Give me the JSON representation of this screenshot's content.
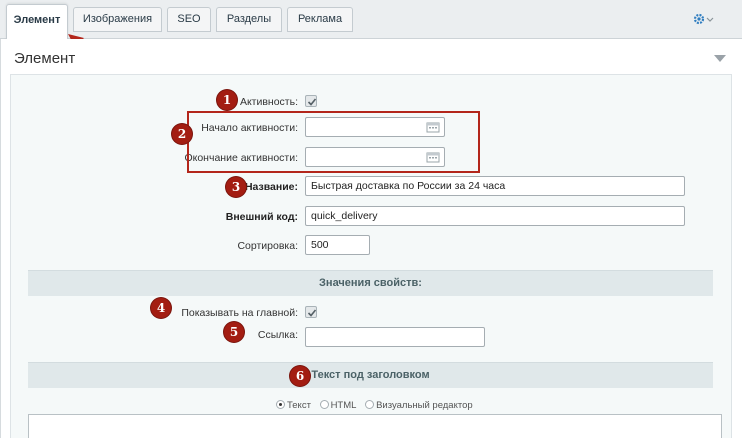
{
  "tabs": [
    {
      "label": "Элемент",
      "active": true
    },
    {
      "label": "Изображения",
      "active": false
    },
    {
      "label": "SEO",
      "active": false
    },
    {
      "label": "Разделы",
      "active": false
    },
    {
      "label": "Реклама",
      "active": false
    }
  ],
  "section": {
    "title": "Элемент"
  },
  "fields": {
    "active": {
      "label": "Активность:",
      "checked": true
    },
    "active_from": {
      "label": "Начало активности:",
      "value": ""
    },
    "active_to": {
      "label": "Окончание активности:",
      "value": ""
    },
    "name": {
      "label": "Название:",
      "value": "Быстрая доставка по России за 24 часа"
    },
    "code": {
      "label": "Внешний код:",
      "value": "quick_delivery"
    },
    "sort": {
      "label": "Сортировка:",
      "value": "500"
    }
  },
  "properties": {
    "title": "Значения свойств:",
    "show_on_main": {
      "label": "Показывать на главной:",
      "checked": true
    },
    "link": {
      "label": "Ссылка:",
      "value": ""
    }
  },
  "subtitle_text": {
    "title": "Текст под заголовком",
    "modes": [
      {
        "label": "Текст",
        "selected": true
      },
      {
        "label": "HTML",
        "selected": false
      },
      {
        "label": "Визуальный редактор",
        "selected": false
      }
    ]
  },
  "annotations": [
    "1",
    "2",
    "3",
    "4",
    "5",
    "6"
  ],
  "colors": {
    "accent_red": "#a31d12",
    "tab_bg": "#ebeef0",
    "panel_bg": "#f5f9f9",
    "bar_bg": "#e0e8ea"
  }
}
